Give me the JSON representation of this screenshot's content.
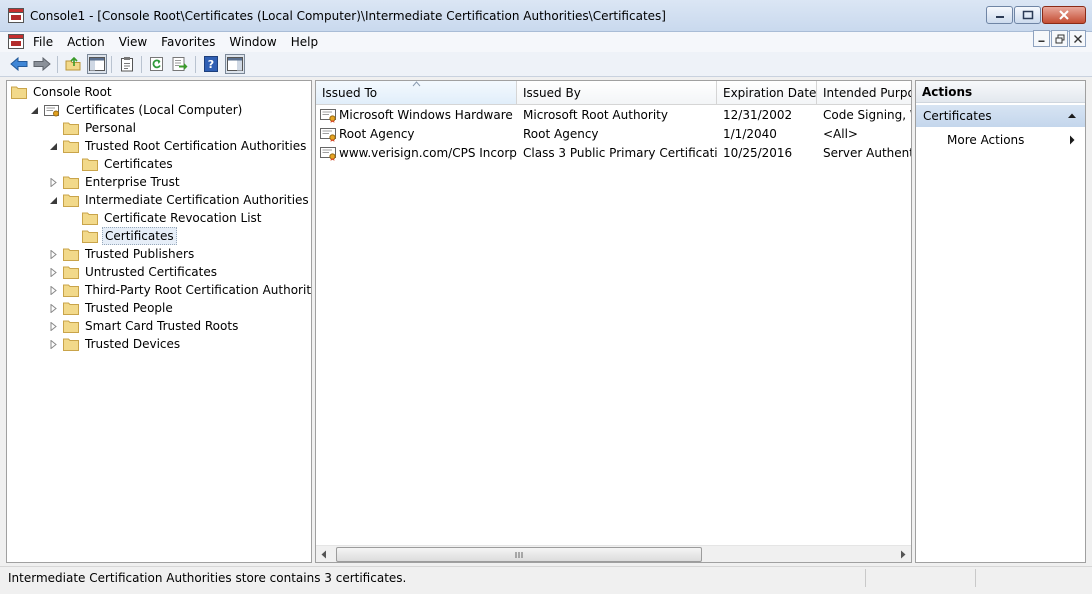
{
  "window": {
    "title": "Console1 - [Console Root\\Certificates (Local Computer)\\Intermediate Certification Authorities\\Certificates]"
  },
  "menu": {
    "items": [
      "File",
      "Action",
      "View",
      "Favorites",
      "Window",
      "Help"
    ]
  },
  "toolbar": {
    "buttons": [
      "back-icon",
      "forward-icon",
      "up-folder-icon",
      "show-hide-tree-icon",
      "properties-icon",
      "refresh-icon",
      "export-list-icon",
      "help-icon",
      "show-hide-action-pane-icon"
    ]
  },
  "tree": {
    "nodes": [
      {
        "label": "Console Root",
        "level": 0,
        "expander": "none"
      },
      {
        "label": "Certificates (Local Computer)",
        "level": 1,
        "expander": "expanded"
      },
      {
        "label": "Personal",
        "level": 2,
        "expander": "none"
      },
      {
        "label": "Trusted Root Certification Authorities",
        "level": 2,
        "expander": "expanded"
      },
      {
        "label": "Certificates",
        "level": 3,
        "expander": "none"
      },
      {
        "label": "Enterprise Trust",
        "level": 2,
        "expander": "collapsed"
      },
      {
        "label": "Intermediate Certification Authorities",
        "level": 2,
        "expander": "expanded"
      },
      {
        "label": "Certificate Revocation List",
        "level": 3,
        "expander": "none"
      },
      {
        "label": "Certificates",
        "level": 3,
        "expander": "none",
        "selected": true
      },
      {
        "label": "Trusted Publishers",
        "level": 2,
        "expander": "collapsed"
      },
      {
        "label": "Untrusted Certificates",
        "level": 2,
        "expander": "collapsed"
      },
      {
        "label": "Third-Party Root Certification Authorities",
        "level": 2,
        "expander": "collapsed"
      },
      {
        "label": "Trusted People",
        "level": 2,
        "expander": "collapsed"
      },
      {
        "label": "Smart Card Trusted Roots",
        "level": 2,
        "expander": "collapsed"
      },
      {
        "label": "Trusted Devices",
        "level": 2,
        "expander": "collapsed"
      }
    ]
  },
  "list": {
    "columns": [
      "Issued To",
      "Issued By",
      "Expiration Date",
      "Intended Purpos"
    ],
    "sorted_column": "Issued To",
    "rows": [
      {
        "issued_to": "Microsoft Windows Hardware ...",
        "issued_by": "Microsoft Root Authority",
        "expiration": "12/31/2002",
        "purpose": "Code Signing, W"
      },
      {
        "issued_to": "Root Agency",
        "issued_by": "Root Agency",
        "expiration": "1/1/2040",
        "purpose": "<All>"
      },
      {
        "issued_to": "www.verisign.com/CPS Incorp....",
        "issued_by": "Class 3 Public Primary Certificatio...",
        "expiration": "10/25/2016",
        "purpose": "Server Authentic"
      }
    ]
  },
  "actions": {
    "title": "Actions",
    "section": "Certificates",
    "more": "More Actions"
  },
  "status": {
    "text": "Intermediate Certification Authorities store contains 3 certificates."
  },
  "colors": {
    "folder": "#f2d98a",
    "selection": "#c4d6ec",
    "back_arrow": "#3f86d6",
    "help_icon": "#2f5fb4"
  }
}
